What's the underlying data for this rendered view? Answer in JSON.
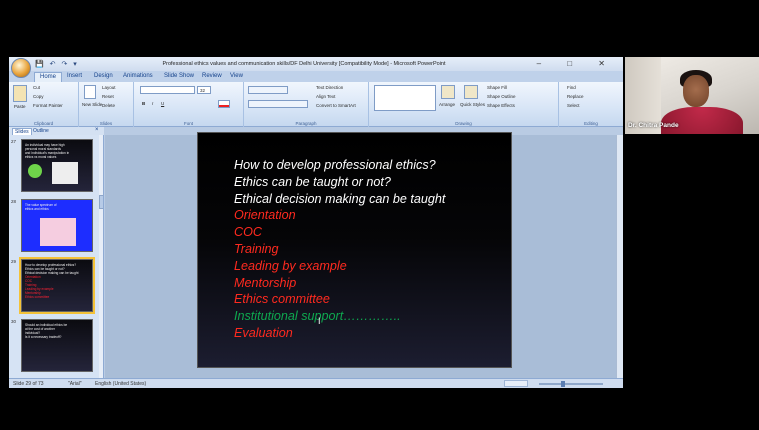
{
  "window": {
    "title": "Professional ethics values and communication skills/DF Delhi University [Compatibility Mode] - Microsoft PowerPoint",
    "controls": "–  □  ✕"
  },
  "qat": "💾 ↶ ↷ ▾",
  "tabs": [
    "Home",
    "Insert",
    "Design",
    "Animations",
    "Slide Show",
    "Review",
    "View"
  ],
  "ribbon": {
    "clipboard": {
      "paste": "Paste",
      "cut": "Cut",
      "copy": "Copy",
      "format_painter": "Format Painter",
      "label": "Clipboard"
    },
    "slides": {
      "new_slide": "New Slide",
      "layout": "Layout",
      "reset": "Reset",
      "delete": "Delete",
      "label": "Slides"
    },
    "font": {
      "size": "32",
      "bold": "B",
      "italic": "I",
      "underline": "U",
      "label": "Font"
    },
    "paragraph": {
      "text_direction": "Text Direction",
      "align_text": "Align Text",
      "convert": "Convert to SmartArt",
      "label": "Paragraph"
    },
    "drawing": {
      "arrange": "Arrange",
      "quick_styles": "Quick Styles",
      "shape_fill": "Shape Fill",
      "shape_outline": "Shape Outline",
      "shape_effects": "Shape Effects",
      "label": "Drawing"
    },
    "editing": {
      "find": "Find",
      "replace": "Replace",
      "select": "Select",
      "label": "Editing"
    }
  },
  "panel": {
    "slides_tab": "Slides",
    "outline_tab": "Outline",
    "close": "×"
  },
  "thumbnails": [
    {
      "num": "27",
      "lines": [
        "An individual may have high",
        "personal moral standards",
        "and Individual's manipulation in",
        "ethics vs moral values"
      ],
      "selected": false
    },
    {
      "num": "28",
      "lines": [
        "The value spectrum of",
        "ethics and ethics"
      ],
      "selected": false
    },
    {
      "num": "29",
      "lines": [
        "How to develop professional ethics?",
        "Ethics can be taught or not?",
        "Ethical decision making can be taught"
      ],
      "red_lines": [
        "Orientation",
        "COC",
        "Training",
        "Leading by example",
        "Mentorship",
        "Ethics committee"
      ],
      "selected": true
    },
    {
      "num": "30",
      "lines": [
        "Should an individual ethics be",
        "at the cost of another",
        "individual?",
        "Is it a necessary tradeoff?"
      ],
      "selected": false
    }
  ],
  "slide": {
    "lines": [
      {
        "text": "How to develop professional ethics?",
        "color": "w"
      },
      {
        "text": "Ethics can be taught or not?",
        "color": "w"
      },
      {
        "text": "Ethical decision making can be taught",
        "color": "w"
      },
      {
        "text": "Orientation",
        "color": "r"
      },
      {
        "text": "COC",
        "color": "r"
      },
      {
        "text": "Training",
        "color": "r"
      },
      {
        "text": "Leading by example",
        "color": "r"
      },
      {
        "text": "Mentorship",
        "color": "r"
      },
      {
        "text": "Ethics committee",
        "color": "r"
      },
      {
        "text": "Institutional support…………..",
        "color": "g"
      },
      {
        "text": "Evaluation",
        "color": "r"
      }
    ]
  },
  "status": {
    "slide": "Slide 29 of 73",
    "theme": "\"Arial\"",
    "language": "English (United States)"
  },
  "video": {
    "name": "Dr. Chitra Pande"
  },
  "colors": {
    "slide_red": "#ff2a1f",
    "slide_green": "#0ea84f",
    "ribbon_blue": "#15428b"
  }
}
